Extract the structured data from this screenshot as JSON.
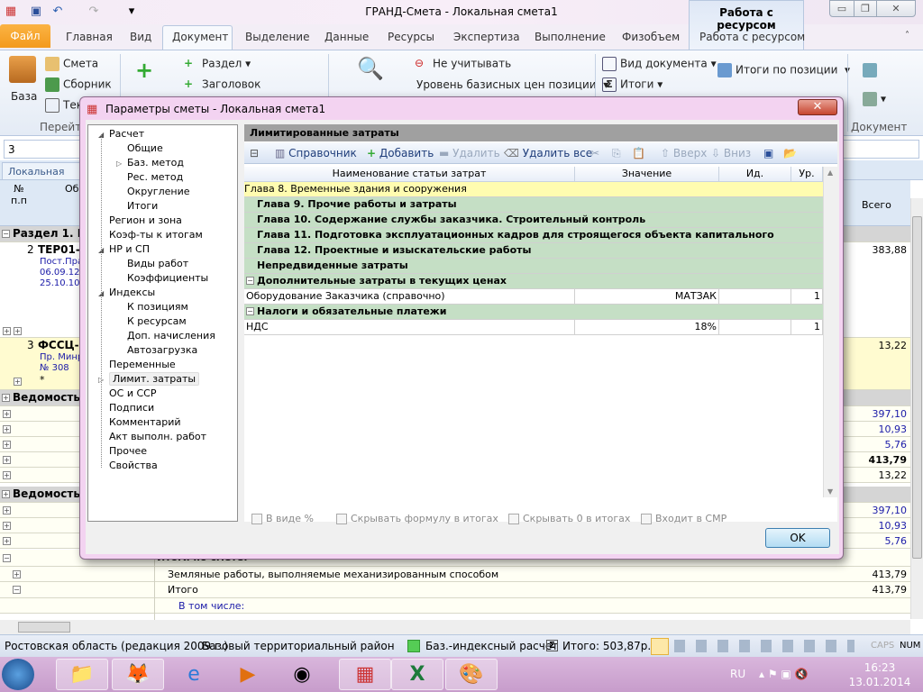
{
  "window": {
    "title": "ГРАНД-Смета - Локальная смета1",
    "context_group": "Работа с ресурсом"
  },
  "tabs": [
    "Файл",
    "Главная",
    "Вид",
    "Документ",
    "Выделение",
    "Данные",
    "Ресурсы",
    "Экспертиза",
    "Выполнение",
    "Физобъем",
    "Работа с ресурсом"
  ],
  "ribbon": {
    "baza": "База",
    "smeta": "Смета",
    "sbornik": "Сборник",
    "tekst": "Текст",
    "goto": "Перейти",
    "razdel": "Раздел",
    "zagolovok": "Заголовок",
    "ne_uchit": "Не учитывать",
    "uroven": "Уровень базисных цен позиции",
    "vid_doc": "Вид документа",
    "itogi": "Итоги",
    "itogi_poz": "Итоги по позиции",
    "document": "Документ"
  },
  "doc": {
    "search_value": "3",
    "doc_tab": "Локальная смет",
    "col_num": "№ п.п",
    "col_obosn": "Об",
    "col_total": "Всего"
  },
  "bg_rows": [
    {
      "text": "Раздел 1. Но",
      "type": "gray"
    },
    {
      "num": "2",
      "code": "ТЕР01-0",
      "sub": [
        "Пост.Пра",
        "06.09.12 N",
        "25.10.10 N"
      ],
      "total": "383,88"
    },
    {
      "num": "3",
      "code": "ФССЦ-1",
      "sub": [
        "Пр. Минр",
        "№ 308"
      ],
      "star": "*",
      "total": "13,22"
    },
    {
      "text": "Ведомость р"
    },
    {
      "values": [
        "397,10",
        "10,93",
        "5,76",
        "413,79",
        "13,22"
      ]
    },
    {
      "text2": "Ведомость р"
    },
    {
      "values2": [
        "397,10",
        "10,93",
        "5,76"
      ]
    },
    {
      "itogi": "Итоги по смете:",
      "zemlya": "Земляные работы, выполняемые механизированным способом",
      "zemlya_total": "413,79",
      "itogo": "Итого",
      "itogo_total": "413,79",
      "vtom": "В том числе:"
    }
  ],
  "dialog": {
    "title": "Параметры сметы - Локальная смета1",
    "tree": [
      {
        "label": "Расчет",
        "level": 0,
        "exp": "open"
      },
      {
        "label": "Общие",
        "level": 1
      },
      {
        "label": "Баз. метод",
        "level": 1,
        "exp": "closed"
      },
      {
        "label": "Рес. метод",
        "level": 1
      },
      {
        "label": "Округление",
        "level": 1
      },
      {
        "label": "Итоги",
        "level": 1
      },
      {
        "label": "Регион и зона",
        "level": 0
      },
      {
        "label": "Коэф-ты к итогам",
        "level": 0
      },
      {
        "label": "НР и СП",
        "level": 0,
        "exp": "open"
      },
      {
        "label": "Виды работ",
        "level": 1
      },
      {
        "label": "Коэффициенты",
        "level": 1
      },
      {
        "label": "Индексы",
        "level": 0,
        "exp": "open"
      },
      {
        "label": "К позициям",
        "level": 1
      },
      {
        "label": "К ресурсам",
        "level": 1
      },
      {
        "label": "Доп. начисления",
        "level": 1
      },
      {
        "label": "Автозагрузка",
        "level": 1
      },
      {
        "label": "Переменные",
        "level": 0
      },
      {
        "label": "Лимит. затраты",
        "level": 0,
        "exp": "closed",
        "selected": true
      },
      {
        "label": "ОС и ССР",
        "level": 0
      },
      {
        "label": "Подписи",
        "level": 0
      },
      {
        "label": "Комментарий",
        "level": 0
      },
      {
        "label": "Акт выполн. работ",
        "level": 0
      },
      {
        "label": "Прочее",
        "level": 0
      },
      {
        "label": "Свойства",
        "level": 0
      }
    ],
    "panel_title": "Лимитированные затраты",
    "toolbar": {
      "spravochnik": "Справочник",
      "add": "Добавить",
      "delete": "Удалить",
      "delete_all": "Удалить все",
      "up": "Вверх",
      "down": "Вниз"
    },
    "columns": [
      "Наименование статьи затрат",
      "Значение",
      "Ид.",
      "Ур."
    ],
    "rows": [
      {
        "name": "Глава 8. Временные здания и сооружения",
        "type": "hl"
      },
      {
        "name": "Глава 9. Прочие работы и затраты",
        "type": "grp"
      },
      {
        "name": "Глава 10. Содержание службы заказчика. Строительный контроль",
        "type": "grp"
      },
      {
        "name": "Глава 11. Подготовка эксплуатационных кадров для строящегося объекта капитального",
        "type": "grp"
      },
      {
        "name": "Глава 12. Проектные и изыскательские работы",
        "type": "grp"
      },
      {
        "name": "Непредвиденные затраты",
        "type": "grp"
      },
      {
        "name": "Дополнительные затраты в текущих ценах",
        "type": "sec"
      },
      {
        "name": "Оборудование Заказчика (справочно)",
        "value": "МАТЗАК",
        "id": "",
        "level": "1",
        "type": "data"
      },
      {
        "name": "Налоги и обязательные платежи",
        "type": "sec"
      },
      {
        "name": "НДС",
        "value": "18%",
        "id": "",
        "level": "1",
        "type": "data"
      }
    ],
    "checkboxes": [
      "В виде %",
      "Скрывать формулу в итогах",
      "Скрывать 0 в итогах",
      "Входит в СМР"
    ],
    "ok": "OK"
  },
  "status": {
    "region": "Ростовская область (редакция 2009 г.)",
    "district": "Базовый территориальный район",
    "calc": "Баз.-индексный расчет",
    "total": "Итого: 503,87р.",
    "caps": "CAPS",
    "num": "NUM"
  },
  "taskbar": {
    "lang": "RU",
    "time": "16:23",
    "date": "13.01.2014"
  }
}
